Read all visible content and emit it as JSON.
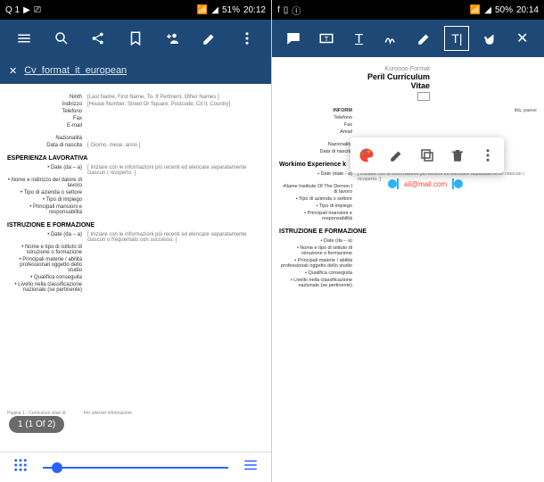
{
  "left": {
    "statusbar": {
      "carrier": "Q 1",
      "battery": "51%",
      "time": "20:12"
    },
    "tab": {
      "filename": "Cv_format_it_european"
    },
    "doc": {
      "fields": {
        "ninth": "Ninth",
        "address": "Indirizzo",
        "phone": "Telefono",
        "fax": "Fax",
        "email": "E-mail",
        "nationality": "Nazionalità",
        "dob": "Data di nascita"
      },
      "placeholders": {
        "name": "[Last Name, First Name, To. If Pertinent, Other Names ]",
        "address": "[House Number, Street Or Square, Postcode, Cit Il, Country]",
        "dob": "[ Giorno, mese, anno ]",
        "work": "[ Iniziare con le informazioni più recenti ed elencare separatamente ciascun r ricoperto. ]",
        "edu": "[ Iniziare con le informazioni più recenti ed elencare separatamente ciascun o frequentato con successo. ]"
      },
      "sections": {
        "work": "ESPERIENZA LAVORATIVA",
        "edu": "ISTRUZIONE E FORMAZIONE"
      },
      "work_items": {
        "date": "• Date (da – a)",
        "employer": "• Nome e indirizzo del datore di lavoro",
        "type": "• Tipo di azienda o settore",
        "role": "• Tipo di impiego",
        "resp": "• Principali mansioni e responsabilità"
      },
      "edu_items": {
        "date": "• Date (da – a)",
        "inst": "• Nome e tipo di istituto di istruzione o formazione",
        "subj": "• Principali materie / abilità professionali oggetto dello studio",
        "qual": "• Qualifica conseguita",
        "level": "• Livello nella classificazione nazionale (se pertinente)"
      },
      "footer": {
        "page": "Pagina 1 - Curriculum vitae di",
        "more": "Per ulteriori informazioni:"
      }
    },
    "page_indicator": "1 (1 Of 2)"
  },
  "right": {
    "statusbar": {
      "battery": "50%",
      "time": "20:14"
    },
    "toolbar_icons": [
      "comment",
      "textbox",
      "text-tool",
      "signature",
      "pen",
      "text-insert",
      "hand",
      "close"
    ],
    "popup_icons": [
      "palette",
      "edit",
      "copy",
      "delete",
      "more"
    ],
    "selection": {
      "email": "ail@mail.com"
    },
    "doc": {
      "title1": "Kuroooo Format",
      "title2": "Peril Curriculum",
      "title3": "Vitae",
      "info_header": "INFORM",
      "info_tail": "ittà, paese",
      "fields": {
        "phone": "Telefono",
        "fax": "Fax",
        "email": "Amail",
        "nationality": "Nazionalità",
        "dob": "Data di nascita"
      },
      "sections": {
        "work": "Workimo Experience k",
        "edu": "ISTRUZIONE E FORMAZIONE"
      },
      "work_items": {
        "date": "• Date (date - a)",
        "employer": "•Name Institute Of The Demon I di lavoro",
        "type": "• Tipo di azienda o settore",
        "role": "• Tipo di impiego",
        "resp": "• Principali mansioni e responsabilità"
      },
      "edu_items": {
        "date": "• Date (da – a)",
        "inst": "• Nome e tipo di istituto di istruzione o formazione",
        "subj": "• Principali materie / abilità professionali oggetto dello studio",
        "qual": "• Qualifica conseguita",
        "level": "• Livello nella classificazione nazionale (se pertinente)"
      },
      "placeholders": {
        "work": "[ Iniziare con le informazioni più recenti ed elencare separatamente ciascun r ricoperto. ]"
      }
    }
  }
}
